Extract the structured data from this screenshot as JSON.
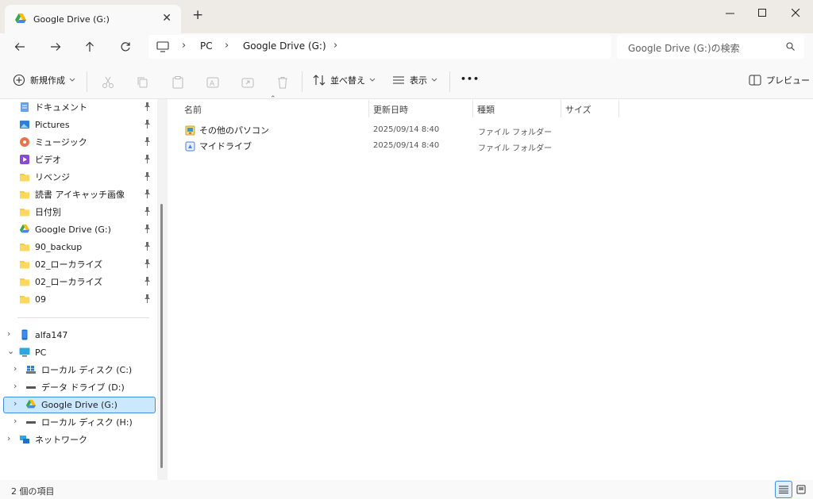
{
  "tab": {
    "title": "Google Drive (G:)",
    "close": "✕",
    "new_tab": "+"
  },
  "window": {
    "minimize": "—",
    "maximize": "☐",
    "close": "✕"
  },
  "nav": {
    "back": "←",
    "forward": "→",
    "up": "↑",
    "refresh": "↻"
  },
  "breadcrumb": {
    "sep": "›",
    "items": [
      "PC",
      "Google Drive (G:)"
    ]
  },
  "search": {
    "placeholder": "Google Drive (G:)の検索"
  },
  "commands": {
    "new": "新規作成",
    "sort": "並べ替え",
    "view": "表示",
    "more": "•••",
    "preview": "プレビュー"
  },
  "quick_access": [
    {
      "label": "ドキュメント",
      "icon": "document-icon"
    },
    {
      "label": "Pictures",
      "icon": "pictures-icon"
    },
    {
      "label": "ミュージック",
      "icon": "music-icon"
    },
    {
      "label": "ビデオ",
      "icon": "video-icon"
    },
    {
      "label": "リベンジ",
      "icon": "folder-icon"
    },
    {
      "label": "読書 アイキャッチ画像",
      "icon": "folder-icon"
    },
    {
      "label": "日付別",
      "icon": "folder-icon"
    },
    {
      "label": "Google Drive (G:)",
      "icon": "google-drive-icon"
    },
    {
      "label": "90_backup",
      "icon": "folder-icon"
    },
    {
      "label": "02_ローカライズ",
      "icon": "folder-icon"
    },
    {
      "label": "02_ローカライズ",
      "icon": "folder-icon"
    },
    {
      "label": "09",
      "icon": "folder-icon"
    }
  ],
  "tree": [
    {
      "label": "alfa147",
      "icon": "phone-icon",
      "chev": "›"
    },
    {
      "label": "PC",
      "icon": "pc-icon",
      "chev": "⌄"
    },
    {
      "label": "ローカル ディスク (C:)",
      "icon": "windows-drive-icon",
      "chev": "›"
    },
    {
      "label": "データ ドライブ (D:)",
      "icon": "drive-icon",
      "chev": "›"
    },
    {
      "label": "Google Drive (G:)",
      "icon": "google-drive-icon",
      "chev": "›"
    },
    {
      "label": "ローカル ディスク (H:)",
      "icon": "drive-icon",
      "chev": "›"
    },
    {
      "label": "ネットワーク",
      "icon": "network-icon",
      "chev": "›"
    }
  ],
  "columns": {
    "name": "名前",
    "modified": "更新日時",
    "type": "種類",
    "size": "サイズ"
  },
  "files": [
    {
      "name": "その他のパソコン",
      "modified": "2025/09/14 8:40",
      "type": "ファイル フォルダー"
    },
    {
      "name": "マイドライブ",
      "modified": "2025/09/14 8:40",
      "type": "ファイル フォルダー"
    }
  ],
  "status": {
    "count": "2 個の項目"
  },
  "colors": {
    "accent": "#3d8de0",
    "folder": "#f8c93b",
    "selection": "#cce8ff"
  }
}
